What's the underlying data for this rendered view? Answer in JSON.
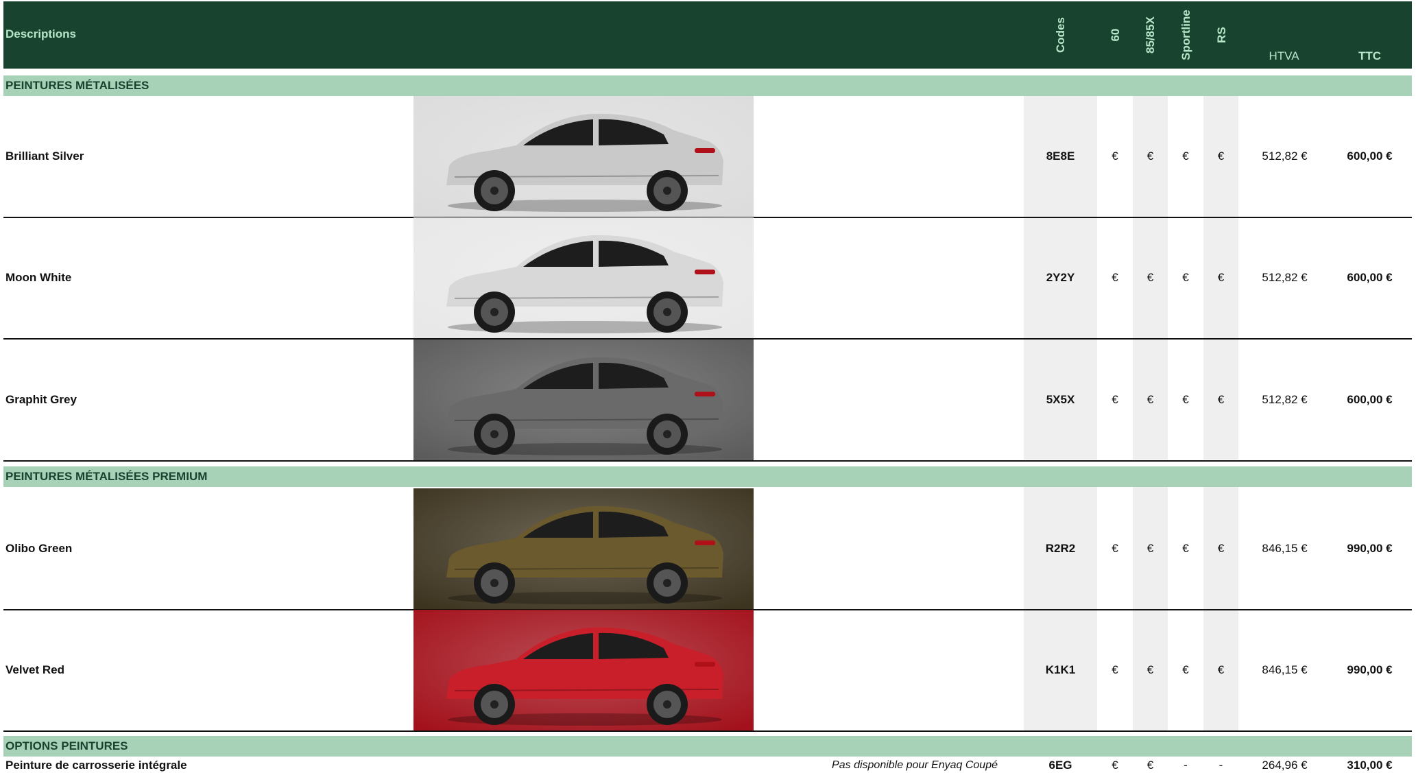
{
  "header": {
    "descriptions": "Descriptions",
    "codes": "Codes",
    "col_60": "60",
    "col_8585x": "85/85X",
    "col_sportline": "Sportline",
    "col_rs": "RS",
    "htva": "HTVA",
    "ttc": "TTC"
  },
  "sections": [
    {
      "title": "PEINTURES MÉTALISÉES",
      "rows": [
        {
          "name": "Brilliant Silver",
          "code": "8E8E",
          "c60": "€",
          "c85": "€",
          "csport": "€",
          "crs": "€",
          "htva": "512,82 €",
          "ttc": "600,00 €",
          "color": "#c9c9c9",
          "bg": "#dcdcdc"
        },
        {
          "name": "Moon White",
          "code": "2Y2Y",
          "c60": "€",
          "c85": "€",
          "csport": "€",
          "crs": "€",
          "htva": "512,82 €",
          "ttc": "600,00 €",
          "color": "#d8d8d8",
          "bg": "#e8e8e8"
        },
        {
          "name": "Graphit Grey",
          "code": "5X5X",
          "c60": "€",
          "c85": "€",
          "csport": "€",
          "crs": "€",
          "htva": "512,82 €",
          "ttc": "600,00 €",
          "color": "#6a6a6a",
          "bg": "#5c5c5c"
        }
      ]
    },
    {
      "title": "PEINTURES MÉTALISÉES PREMIUM",
      "rows": [
        {
          "name": "Olibo Green",
          "code": "R2R2",
          "c60": "€",
          "c85": "€",
          "csport": "€",
          "crs": "€",
          "htva": "846,15 €",
          "ttc": "990,00 €",
          "color": "#6b5a2e",
          "bg": "#3d3420"
        },
        {
          "name": "Velvet Red",
          "code": "K1K1",
          "c60": "€",
          "c85": "€",
          "csport": "€",
          "crs": "€",
          "htva": "846,15 €",
          "ttc": "990,00 €",
          "color": "#c81f2a",
          "bg": "#a3121c"
        }
      ]
    },
    {
      "title": "OPTIONS PEINTURES",
      "rows": [
        {
          "name": "Peinture de carrosserie intégrale",
          "note": "Pas disponible pour Enyaq Coupé",
          "code": "6EG",
          "c60": "€",
          "c85": "€",
          "csport": "-",
          "crs": "-",
          "htva": "264,96 €",
          "ttc": "310,00 €"
        }
      ]
    }
  ]
}
